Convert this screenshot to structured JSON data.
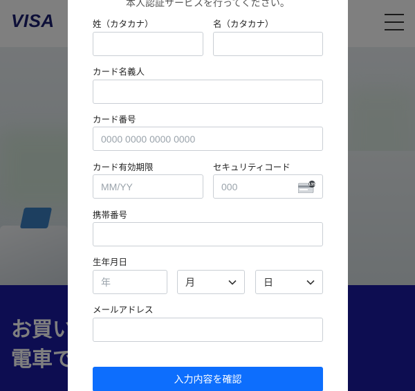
{
  "background": {
    "logo": "VISA",
    "headline_line1": "お買い",
    "headline_line2": "電車で"
  },
  "modal": {
    "subtitle": "本人認証サービスを行ってください。",
    "fields": {
      "last_name_kana": {
        "label": "姓（カタカナ）",
        "value": "",
        "placeholder": ""
      },
      "first_name_kana": {
        "label": "名（カタカナ）",
        "value": "",
        "placeholder": ""
      },
      "card_holder": {
        "label": "カード名義人",
        "value": "",
        "placeholder": ""
      },
      "card_number": {
        "label": "カード番号",
        "value": "",
        "placeholder": "0000 0000 0000 0000"
      },
      "expiry": {
        "label": "カード有効期限",
        "value": "",
        "placeholder": "MM/YY"
      },
      "security_code": {
        "label": "セキュリティコード",
        "value": "",
        "placeholder": "000"
      },
      "mobile": {
        "label": "携帯番号",
        "value": "",
        "placeholder": ""
      },
      "birth": {
        "label": "生年月日",
        "year_placeholder": "年",
        "month_selected": "月",
        "day_selected": "日"
      },
      "email": {
        "label": "メールアドレス",
        "value": "",
        "placeholder": ""
      }
    },
    "submit_label": "入力内容を確認"
  },
  "colors": {
    "primary_button": "#0d6efd",
    "brand_blue": "#1a1f71",
    "banner_blue": "#1a1ba3"
  },
  "icons": {
    "menu": "hamburger-menu-icon",
    "card": "credit-card-cvv-icon",
    "select": "chevron-down-icon"
  }
}
